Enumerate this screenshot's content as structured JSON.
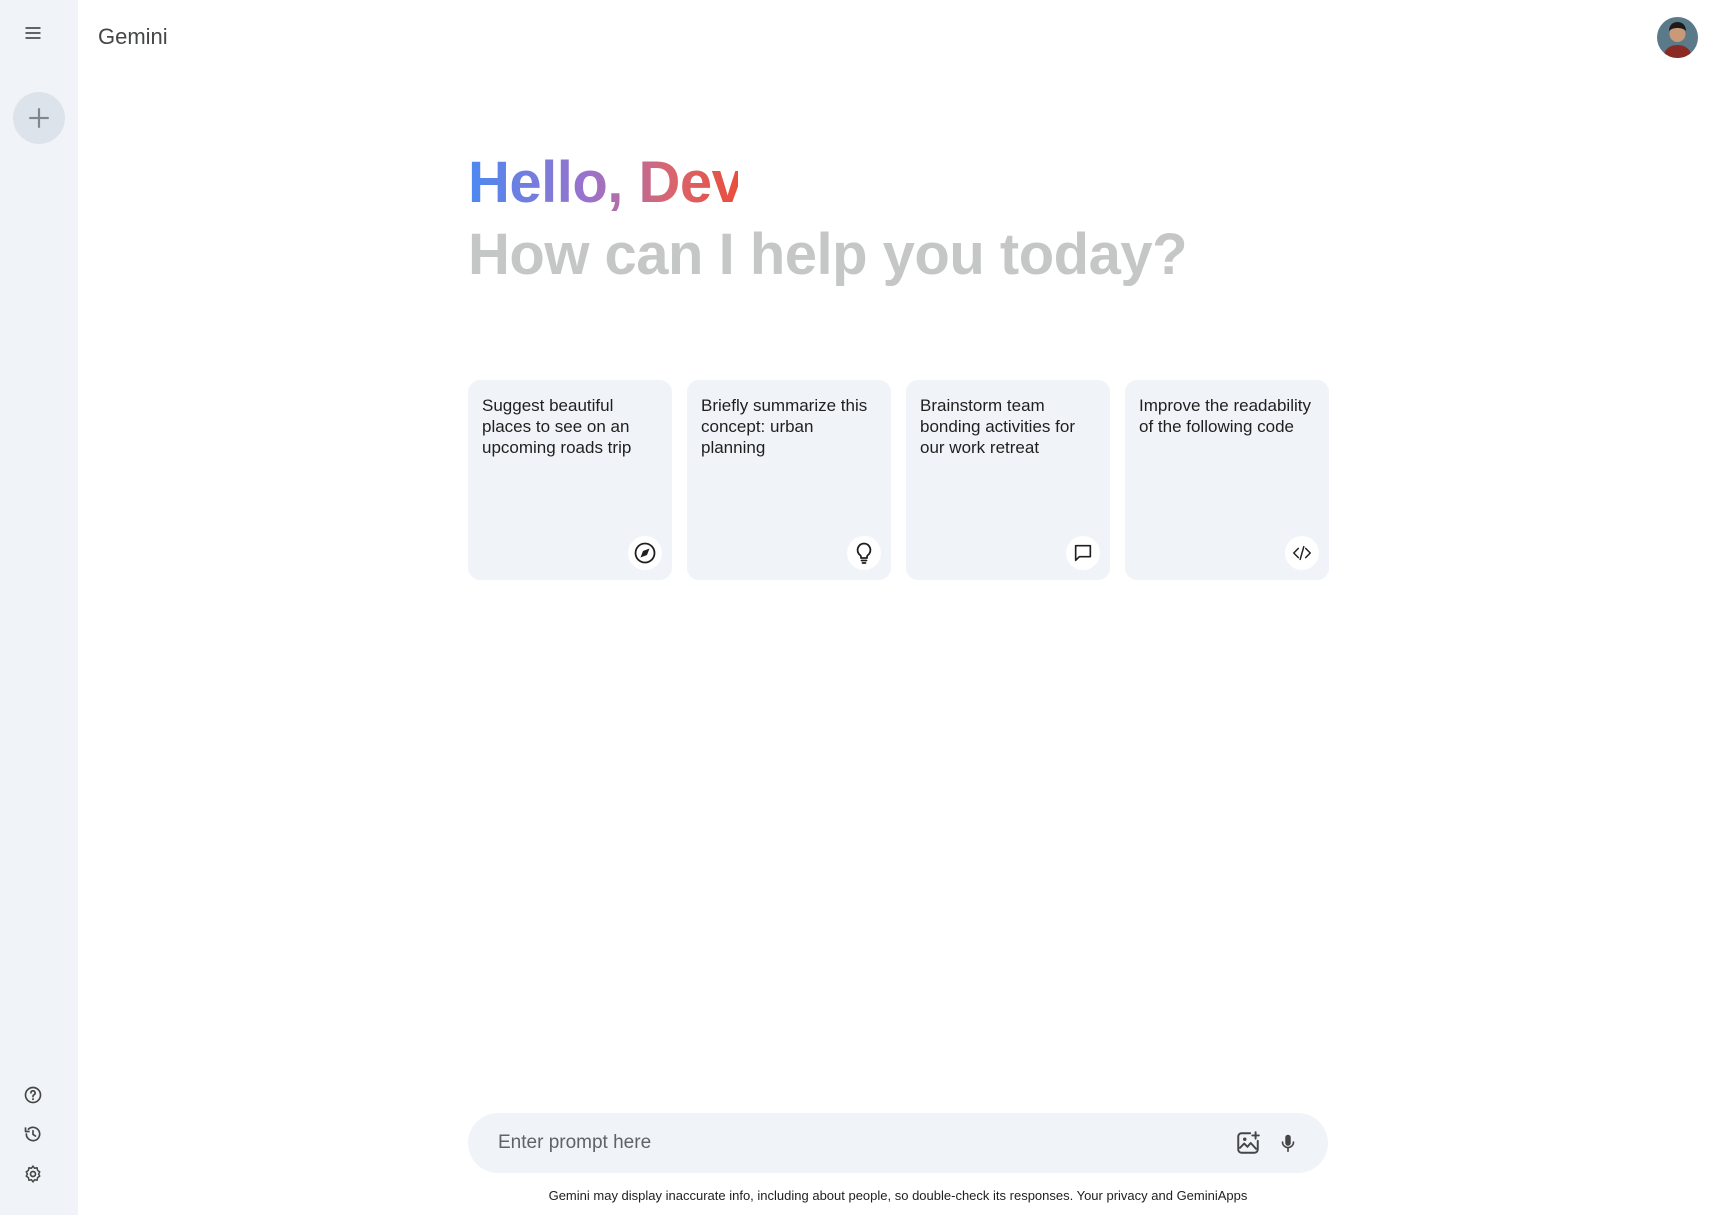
{
  "app": {
    "title": "Gemini"
  },
  "sidebar": {
    "menu_icon": "menu-icon",
    "new_chat_icon": "plus-icon",
    "help_icon": "help-icon",
    "activity_icon": "history-icon",
    "settings_icon": "gear-icon"
  },
  "greeting": {
    "hello": "Hello, Dev.",
    "subtitle": "How can I help you today?"
  },
  "cards": [
    {
      "text": "Suggest beautiful places to see on an upcoming roads trip",
      "icon": "compass-icon"
    },
    {
      "text": "Briefly summarize this concept: urban planning",
      "icon": "lightbulb-icon"
    },
    {
      "text": "Brainstorm team bonding activities for our work retreat",
      "icon": "chat-bubble-icon"
    },
    {
      "text": "Improve the readability of the following code",
      "icon": "code-icon"
    }
  ],
  "prompt": {
    "placeholder": "Enter prompt here",
    "image_icon": "add-image-icon",
    "mic_icon": "mic-icon"
  },
  "footer": {
    "disclaimer": "Gemini may display inaccurate info, including about people, so double-check its responses. Your privacy and GeminiApps"
  },
  "colors": {
    "sidebar_bg": "#f0f4f9",
    "card_bg": "#f0f4f9",
    "greeting_start": "#4b89f1",
    "greeting_end": "#e94e3c",
    "subtitle": "#c4c7c5"
  }
}
